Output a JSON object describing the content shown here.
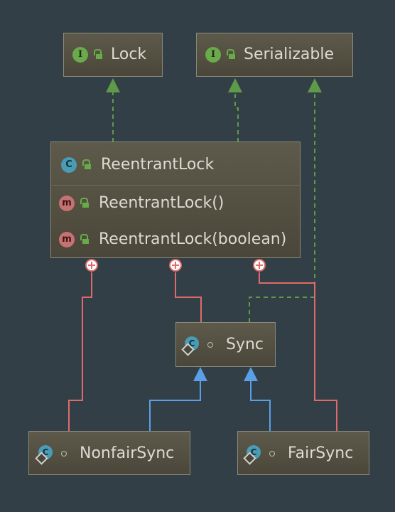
{
  "nodes": {
    "lock": {
      "name": "Lock",
      "kind": "interface",
      "badge": "I"
    },
    "serializable": {
      "name": "Serializable",
      "kind": "interface",
      "badge": "I"
    },
    "reentrantlock": {
      "name": "ReentrantLock",
      "kind": "class",
      "badge": "C",
      "methods": [
        {
          "badge": "m",
          "signature": "ReentrantLock()"
        },
        {
          "badge": "m",
          "signature": "ReentrantLock(boolean)"
        }
      ]
    },
    "sync": {
      "name": "Sync",
      "kind": "abstract-class",
      "badge": "C"
    },
    "nonfairsync": {
      "name": "NonfairSync",
      "kind": "class",
      "badge": "C"
    },
    "fairsync": {
      "name": "FairSync",
      "kind": "class",
      "badge": "C"
    }
  },
  "edges": [
    {
      "from": "reentrantlock",
      "to": "lock",
      "type": "implements"
    },
    {
      "from": "reentrantlock",
      "to": "serializable",
      "type": "implements"
    },
    {
      "from": "sync",
      "to": "serializable",
      "type": "implements"
    },
    {
      "from": "nonfairsync",
      "to": "sync",
      "type": "extends"
    },
    {
      "from": "fairsync",
      "to": "sync",
      "type": "extends"
    },
    {
      "from": "reentrantlock",
      "to": "sync",
      "type": "inner-class"
    },
    {
      "from": "reentrantlock",
      "to": "nonfairsync",
      "type": "inner-class"
    },
    {
      "from": "reentrantlock",
      "to": "fairsync",
      "type": "inner-class"
    }
  ],
  "colors": {
    "background": "#333f46",
    "implements": "#5f9a4a",
    "extends": "#5aa0e8",
    "inner": "#e06a6a"
  }
}
